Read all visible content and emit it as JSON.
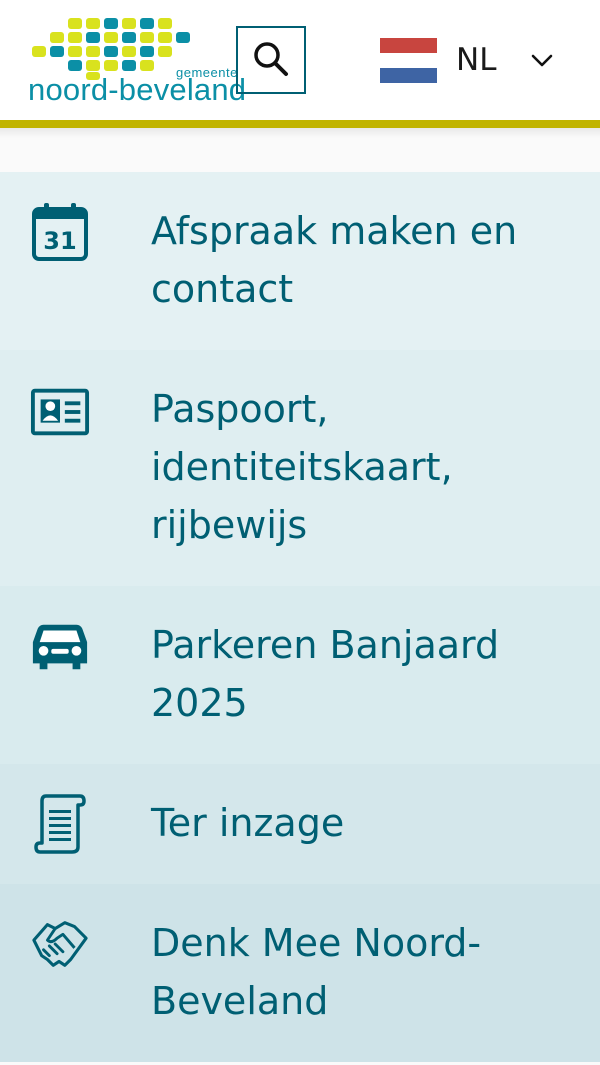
{
  "header": {
    "logo_small": "gemeente",
    "logo_big": "noord-beveland",
    "search_icon": "search-icon",
    "language": {
      "code": "NL",
      "flag_colors": [
        "#c8453f",
        "#ffffff",
        "#3e64a4"
      ]
    }
  },
  "colors": {
    "accent_bar": "#c1b400",
    "text": "#005f73",
    "logo_teal": "#0b8fa6",
    "logo_yellow": "#d9e21e"
  },
  "menu": [
    {
      "label": "Afspraak maken en contact",
      "icon": "calendar-icon",
      "bg": "#e4f1f3"
    },
    {
      "label": "Paspoort, identiteitskaart, rijbewijs",
      "icon": "id-card-icon",
      "bg": "#dfeef1"
    },
    {
      "label": "Parkeren Banjaard 2025",
      "icon": "car-icon",
      "bg": "#d9ebee"
    },
    {
      "label": "Ter inzage",
      "icon": "document-icon",
      "bg": "#d4e7eb"
    },
    {
      "label": "Denk Mee Noord-Beveland",
      "icon": "handshake-icon",
      "bg": "#cee3e8"
    }
  ]
}
